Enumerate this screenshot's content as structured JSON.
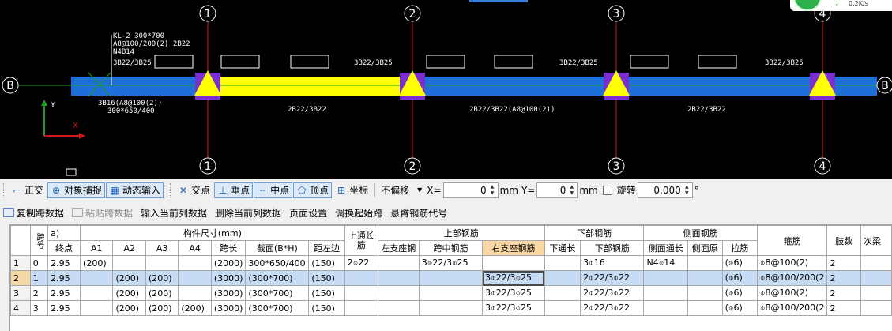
{
  "drawing": {
    "axes_top": [
      "1",
      "2",
      "3",
      "4"
    ],
    "axes_bottom": [
      "1",
      "2",
      "3",
      "4"
    ],
    "row_axis_left": "B",
    "row_axis_right": "B",
    "beam_annotation": [
      "KL-2 300*700",
      "A8@100/200(2) 2B22",
      "N4B14",
      "3B22/3B25"
    ],
    "top_bar_labels": [
      "3B22/3B25",
      "3B22/3B25",
      "3B22/3B25"
    ],
    "bottom_labels": [
      "3B16(A8@100(2))",
      "300*650/400",
      "2B22/3B22",
      "2B22/3B22(A8@100(2))",
      "2B22/3B22"
    ],
    "ucs_x": "X",
    "ucs_y": "Y",
    "beam_color": "#1e6fd9",
    "highlight_color": "#ffff00",
    "support_color": "#7b2fd0",
    "axis_color": "#d01818"
  },
  "network": {
    "speed": "0.2K/s",
    "arrow": "↓"
  },
  "snapbar": {
    "ortho": "正交",
    "object_snap": "对象捕捉",
    "dynamic_input": "动态输入",
    "intersection": "交点",
    "perpendicular": "垂点",
    "midpoint": "中点",
    "vertex": "顶点",
    "coordinate": "坐标",
    "offset_mode": "不偏移",
    "x_label": "X=",
    "x_value": "0",
    "mm1": "mm",
    "y_label": "Y=",
    "y_value": "0",
    "mm2": "mm",
    "rotate": "旋转",
    "rotate_value": "0.000",
    "degree": "°"
  },
  "editbar": {
    "copy_span": "复制跨数据",
    "paste_span": "粘贴跨数据",
    "input_column": "输入当前列数据",
    "delete_column": "删除当前列数据",
    "page_setup": "页面设置",
    "adjust_start": "调换起始跨",
    "cantilever_code": "悬臂钢筋代号"
  },
  "grid": {
    "group_headers": {
      "span_no": "跨号",
      "dims": "构件尺寸(mm)",
      "top_through": "上通长筋",
      "top_steel": "上部钢筋",
      "bottom_steel": "下部钢筋",
      "side_steel": "侧面钢筋",
      "stirrup": "箍筋",
      "legs": "肢数",
      "next": "次梁",
      "left_partial": "a)"
    },
    "sub_headers": {
      "end": "终点",
      "a1": "A1",
      "a2": "A2",
      "a3": "A3",
      "a4": "A4",
      "span_len": "跨长",
      "section": "截面(B*H)",
      "dist_edge": "距左边",
      "left_seat": "左支座钢",
      "mid_span": "跨中钢筋",
      "right_seat": "右支座钢筋",
      "bottom_through": "下通长",
      "bottom_bars": "下部钢筋",
      "side_through": "侧面通长",
      "side_orig": "侧面原",
      "tie": "拉筋"
    },
    "rows": [
      {
        "idx": "1",
        "span": "0",
        "end": "2.95",
        "a1": "(200)",
        "a2": "",
        "a3": "",
        "a4": "",
        "len": "(2000)",
        "sec": "300*650/400",
        "dist": "(150)",
        "top_through": "2⌽22",
        "left": "",
        "mid": "3⌽22/3⌽25",
        "right": "",
        "bt": "",
        "bottom": "3⌽16",
        "side_t": "N4⌽14",
        "side_o": "",
        "tie": "(⌽6)",
        "stirrup": "⌽8@100(2)",
        "legs": "2",
        "next": ""
      },
      {
        "idx": "2",
        "span": "1",
        "end": "2.95",
        "a1": "",
        "a2": "(200)",
        "a3": "(200)",
        "a4": "",
        "len": "(3000)",
        "sec": "(300*700)",
        "dist": "(150)",
        "top_through": "",
        "left": "",
        "mid": "",
        "right": "3⌽22/3⌽25",
        "bt": "",
        "bottom": "2⌽22/3⌽22",
        "side_t": "",
        "side_o": "",
        "tie": "(⌽6)",
        "stirrup": "⌽8@100/200(2",
        "legs": "2",
        "next": ""
      },
      {
        "idx": "3",
        "span": "2",
        "end": "2.95",
        "a1": "",
        "a2": "(200)",
        "a3": "(200)",
        "a4": "",
        "len": "(3000)",
        "sec": "(300*700)",
        "dist": "(150)",
        "top_through": "",
        "left": "",
        "mid": "",
        "right": "3⌽22/3⌽25",
        "bt": "",
        "bottom": "2⌽22/3⌽22",
        "side_t": "",
        "side_o": "",
        "tie": "(⌽6)",
        "stirrup": "⌽8@100(2)",
        "legs": "2",
        "next": ""
      },
      {
        "idx": "4",
        "span": "3",
        "end": "2.95",
        "a1": "",
        "a2": "(200)",
        "a3": "(200)",
        "a4": "(200)",
        "len": "(3000)",
        "sec": "(300*700)",
        "dist": "(150)",
        "top_through": "",
        "left": "",
        "mid": "",
        "right": "3⌽22/3⌽25",
        "bt": "",
        "bottom": "2⌽22/3⌽22",
        "side_t": "",
        "side_o": "",
        "tie": "(⌽6)",
        "stirrup": "⌽8@100/200(2",
        "legs": "2",
        "next": ""
      }
    ]
  }
}
